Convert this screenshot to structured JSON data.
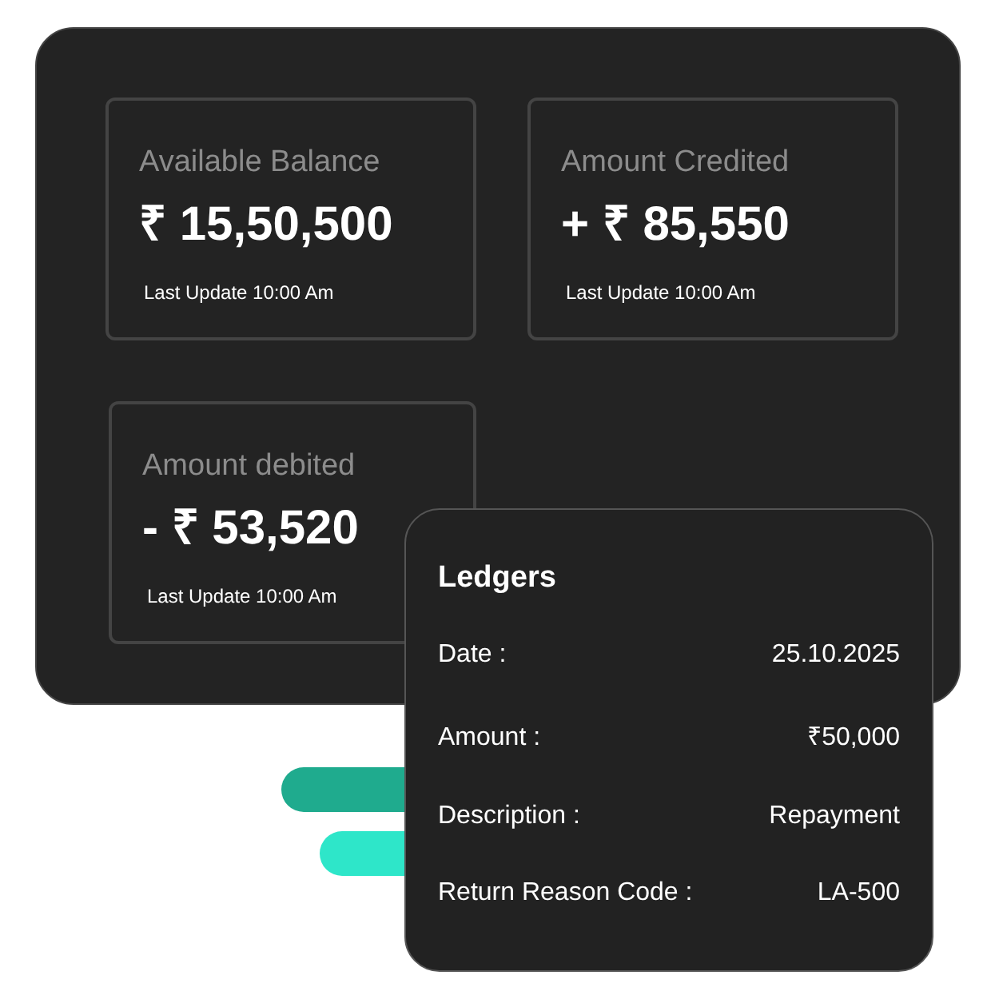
{
  "summary_cards": [
    {
      "label": "Available Balance",
      "amount": "₹ 15,50,500",
      "updated": "Last Update 10:00 Am"
    },
    {
      "label": "Amount Credited",
      "amount": "+ ₹ 85,550",
      "updated": "Last Update 10:00 Am"
    },
    {
      "label": "Amount debited",
      "amount": "- ₹ 53,520",
      "updated": "Last Update 10:00 Am"
    }
  ],
  "ledger": {
    "title": "Ledgers",
    "rows": [
      {
        "label": "Date :",
        "value": "25.10.2025"
      },
      {
        "label": "Amount :",
        "value": "₹50,000"
      },
      {
        "label": "Description :",
        "value": "Repayment"
      },
      {
        "label": "Return Reason Code :",
        "value": "LA-500"
      }
    ]
  }
}
